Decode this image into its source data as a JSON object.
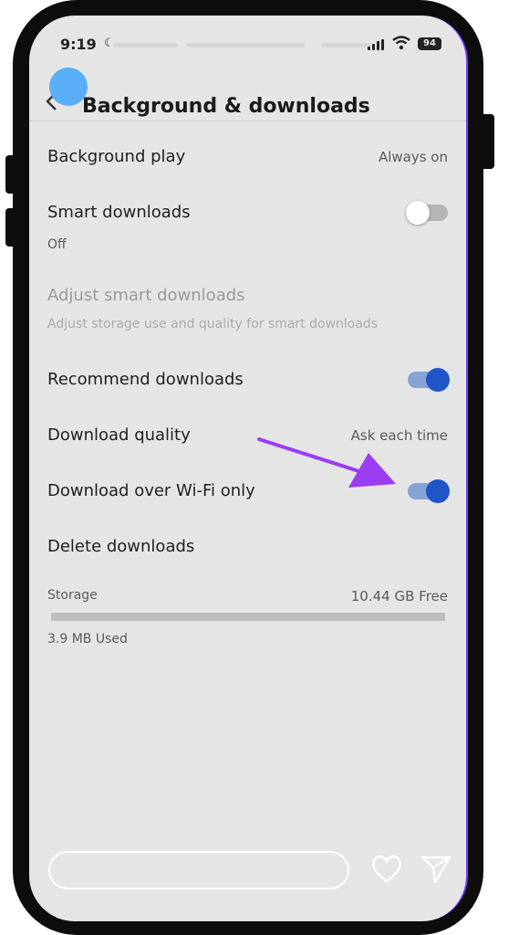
{
  "status_bar": {
    "time": "9:19",
    "battery": "94"
  },
  "header": {
    "title": "Background & downloads"
  },
  "settings": {
    "background_play": {
      "label": "Background play",
      "value": "Always on"
    },
    "smart_downloads": {
      "label": "Smart downloads",
      "sub": "Off",
      "enabled": false
    },
    "adjust_smart_downloads": {
      "label": "Adjust smart downloads",
      "sub": "Adjust storage use and quality for smart downloads"
    },
    "recommend_downloads": {
      "label": "Recommend downloads",
      "enabled": true
    },
    "download_quality": {
      "label": "Download quality",
      "value": "Ask each time"
    },
    "download_over_wifi": {
      "label": "Download over Wi-Fi only",
      "enabled": true
    },
    "delete_downloads": {
      "label": "Delete downloads"
    }
  },
  "storage": {
    "label": "Storage",
    "free": "10.44 GB Free",
    "used": "3.9 MB Used"
  },
  "colors": {
    "accent": "#1f55c7",
    "annotation_arrow": "#9b3df0",
    "back_dot": "#59aef7"
  },
  "icons": [
    "moon-icon",
    "signal-icon",
    "wifi-icon",
    "battery-icon",
    "back-chevron-icon",
    "heart-icon",
    "send-icon",
    "annotation-arrow-icon"
  ]
}
